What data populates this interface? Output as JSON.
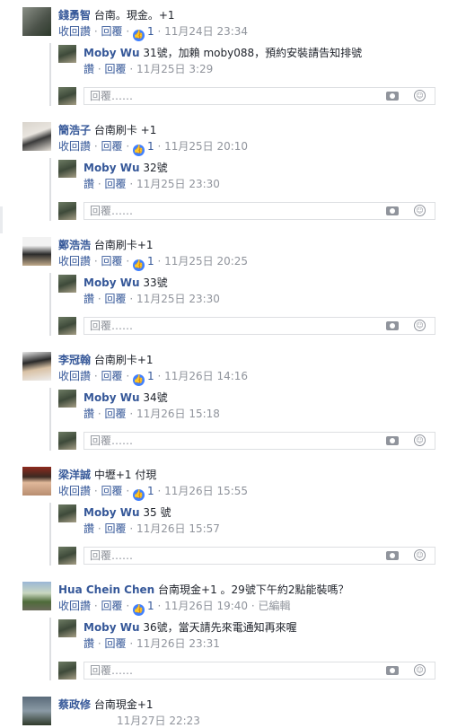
{
  "labels": {
    "withdraw_like": "收回讚",
    "like": "讚",
    "reply": "回覆",
    "sep": "·",
    "reply_placeholder": "回覆……",
    "like_count": "1",
    "edited": "已編輯"
  },
  "comments": [
    {
      "author": "錢勇智",
      "text": "台南。現金。+1",
      "liked": true,
      "likes": "1",
      "time": "11月24日 23:34",
      "reply": {
        "author": "Moby Wu",
        "text": "31號，加賴 moby088，預約安裝請告知排號",
        "time": "11月25日 3:29"
      }
    },
    {
      "author": "簡浩子",
      "text": "台南刷卡 +1",
      "liked": true,
      "likes": "1",
      "time": "11月25日 20:10",
      "reply": {
        "author": "Moby Wu",
        "text": "32號",
        "time": "11月25日 23:30"
      }
    },
    {
      "author": "鄭浩浩",
      "text": "台南刷卡+1",
      "liked": true,
      "likes": "1",
      "time": "11月25日 20:25",
      "reply": {
        "author": "Moby Wu",
        "text": "33號",
        "time": "11月25日 23:30"
      }
    },
    {
      "author": "李冠翰",
      "text": "台南刷卡+1",
      "liked": true,
      "likes": "1",
      "time": "11月26日 14:16",
      "reply": {
        "author": "Moby Wu",
        "text": "34號",
        "time": "11月26日 15:18"
      }
    },
    {
      "author": "梁洋誠",
      "text": "中壢+1 付現",
      "liked": true,
      "likes": "1",
      "time": "11月26日 15:55",
      "reply": {
        "author": "Moby Wu",
        "text": "35 號",
        "time": "11月26日 15:57"
      }
    },
    {
      "author": "Hua Chein Chen",
      "text": "台南現金+1 。29號下午約2點能裝嗎？",
      "liked": true,
      "likes": "1",
      "time": "11月26日 19:40",
      "edited": true,
      "reply": {
        "author": "Moby Wu",
        "text": "36號，當天請先來電通知再來喔",
        "time": "11月26日 23:31"
      }
    },
    {
      "author": "蔡政修",
      "text": "台南現金+1",
      "time": "11月27日 22:23"
    }
  ],
  "colors": {
    "link": "#365899",
    "meta": "#90949c",
    "like_badge": "#4080ff"
  }
}
